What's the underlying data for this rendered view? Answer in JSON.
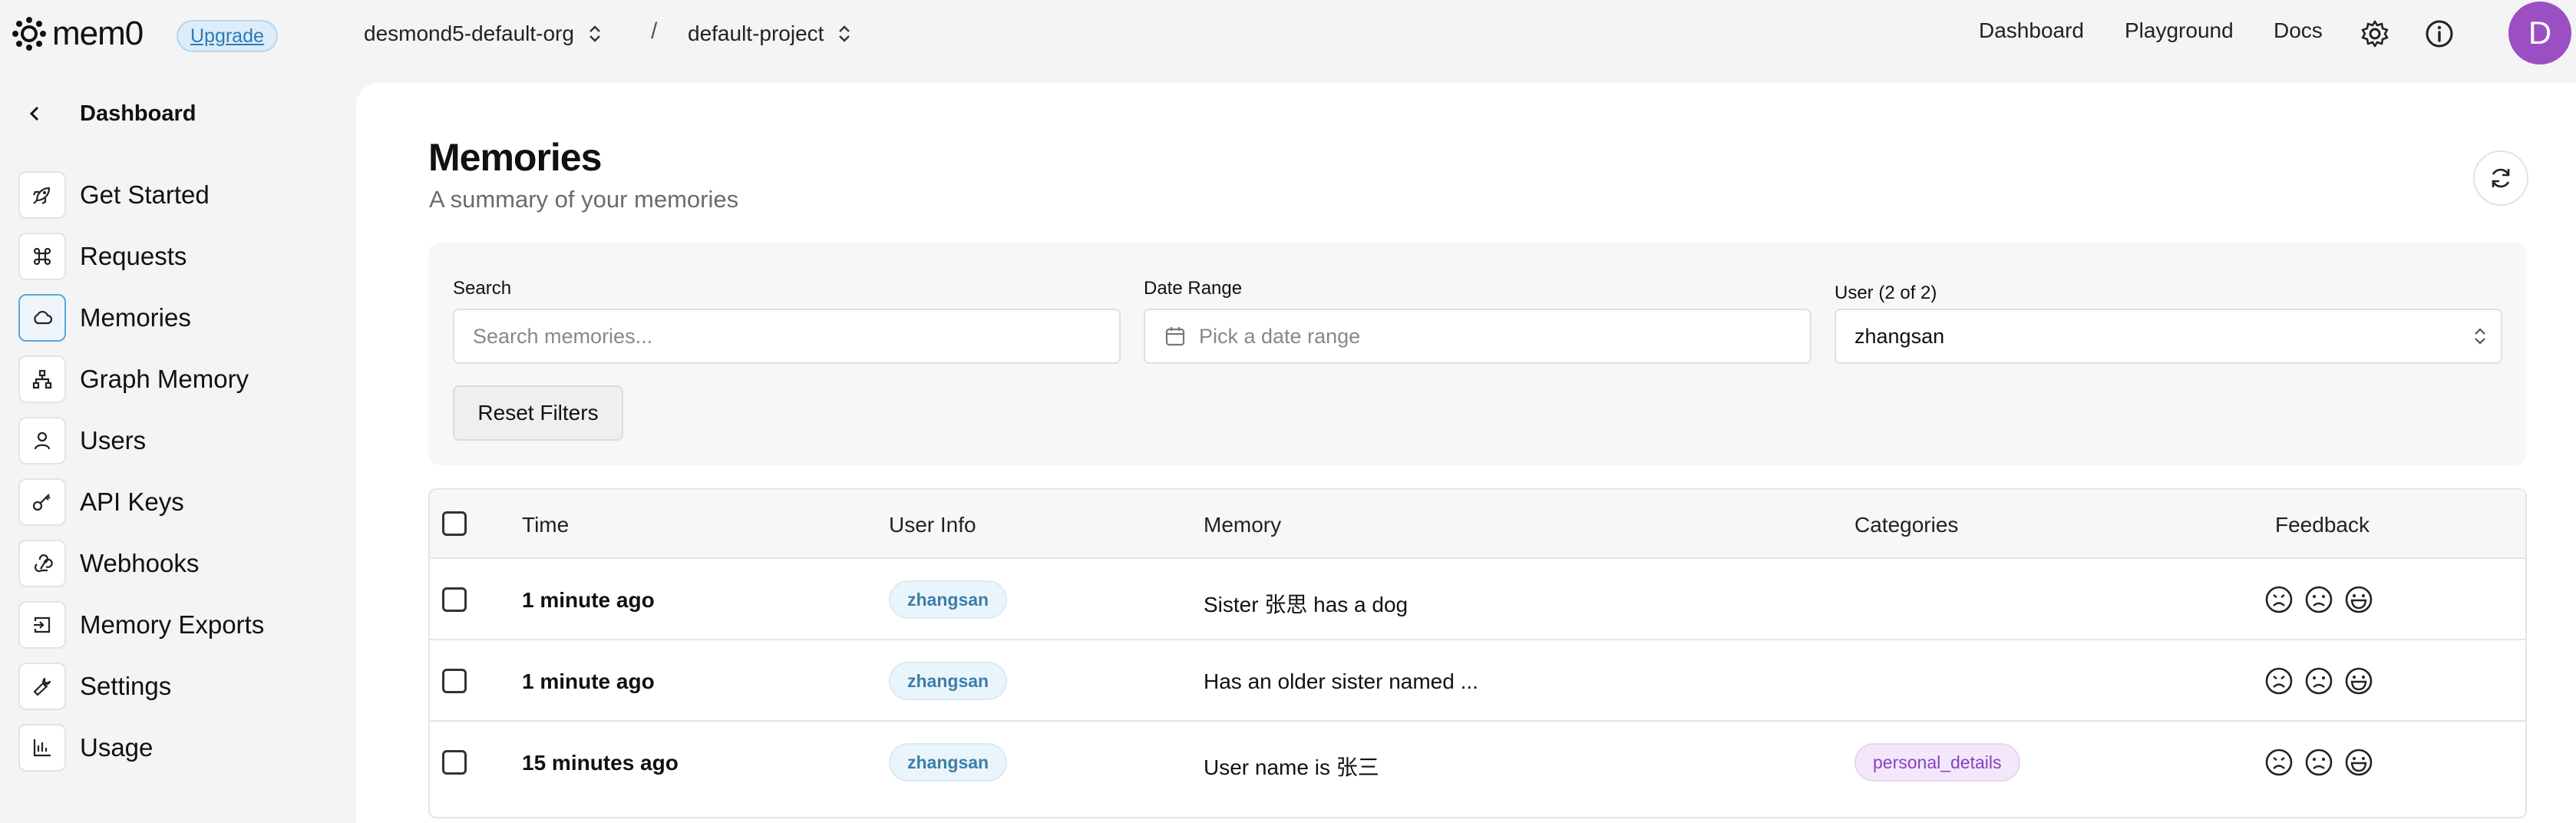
{
  "brand": {
    "logo_text": "mem0",
    "upgrade_label": "Upgrade"
  },
  "breadcrumb": {
    "org": "desmond5-default-org",
    "separator": "/",
    "project": "default-project"
  },
  "topnav": {
    "dashboard": "Dashboard",
    "playground": "Playground",
    "docs": "Docs",
    "avatar_initial": "D"
  },
  "sidebar": {
    "back_label": "Dashboard",
    "items": [
      {
        "label": "Get Started",
        "icon": "rocket-icon"
      },
      {
        "label": "Requests",
        "icon": "command-icon"
      },
      {
        "label": "Memories",
        "icon": "cloud-icon",
        "active": true
      },
      {
        "label": "Graph Memory",
        "icon": "graph-icon"
      },
      {
        "label": "Users",
        "icon": "user-icon"
      },
      {
        "label": "API Keys",
        "icon": "key-icon"
      },
      {
        "label": "Webhooks",
        "icon": "webhook-icon"
      },
      {
        "label": "Memory Exports",
        "icon": "export-icon"
      },
      {
        "label": "Settings",
        "icon": "wrench-icon"
      },
      {
        "label": "Usage",
        "icon": "chart-icon"
      }
    ]
  },
  "page": {
    "title": "Memories",
    "subtitle": "A summary of your memories"
  },
  "filters": {
    "search_label": "Search",
    "search_placeholder": "Search memories...",
    "date_label": "Date Range",
    "date_placeholder": "Pick a date range",
    "user_label": "User (2 of 2)",
    "user_value": "zhangsan",
    "reset_label": "Reset Filters"
  },
  "table": {
    "headers": {
      "time": "Time",
      "user_info": "User Info",
      "memory": "Memory",
      "categories": "Categories",
      "feedback": "Feedback"
    },
    "rows": [
      {
        "time": "1 minute ago",
        "user": "zhangsan",
        "memory": "Sister 张思 has a dog",
        "category": ""
      },
      {
        "time": "1 minute ago",
        "user": "zhangsan",
        "memory": "Has an older sister named ...",
        "category": ""
      },
      {
        "time": "15 minutes ago",
        "user": "zhangsan",
        "memory": "User name is 张三",
        "category": "personal_details"
      }
    ]
  },
  "colors": {
    "accent": "#5ba7d6",
    "avatar": "#9b4fc2",
    "category_chip": "#8a3fc1"
  }
}
